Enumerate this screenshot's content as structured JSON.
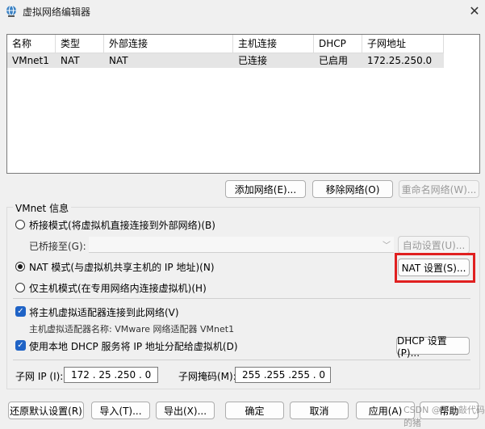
{
  "window": {
    "title": "虚拟网络编辑器",
    "close_glyph": "✕"
  },
  "table": {
    "columns": [
      "名称",
      "类型",
      "外部连接",
      "主机连接",
      "DHCP",
      "子网地址"
    ],
    "rows": [
      {
        "name": "VMnet1",
        "type": "NAT",
        "external": "NAT",
        "host": "已连接",
        "dhcp": "已启用",
        "subnet": "172.25.250.0"
      }
    ]
  },
  "table_buttons": {
    "add": "添加网络(E)...",
    "remove": "移除网络(O)",
    "rename": "重命名网络(W)..."
  },
  "vmnet_info": {
    "label": "VMnet 信息",
    "bridged_label": "桥接模式(将虚拟机直接连接到外部网络)(B)",
    "bridged_to_label": "已桥接至(G):",
    "bridged_to_value": "",
    "auto_settings": "自动设置(U)...",
    "nat_label": "NAT 模式(与虚拟机共享主机的 IP 地址)(N)",
    "nat_settings": "NAT 设置(S)...",
    "hostonly_label": "仅主机模式(在专用网络内连接虚拟机)(H)",
    "connect_adapter_label": "将主机虚拟适配器连接到此网络(V)",
    "adapter_name_label": "主机虚拟适配器名称: VMware 网络适配器 VMnet1",
    "dhcp_label": "使用本地 DHCP 服务将 IP 地址分配给虚拟机(D)",
    "dhcp_settings": "DHCP 设置(P)...",
    "subnet_ip_label": "子网 IP (I):",
    "subnet_ip_value": "172 . 25 .250 . 0",
    "subnet_mask_label": "子网掩码(M):",
    "subnet_mask_value": "255 .255 .255 . 0",
    "mode_selected": "nat"
  },
  "footer": {
    "restore": "还原默认设置(R)",
    "import": "导入(T)...",
    "export": "导出(X)...",
    "ok": "确定",
    "cancel": "取消",
    "apply": "应用(A)",
    "help": "帮助"
  },
  "watermark": "CSDN @不会敲代码的猪",
  "colors": {
    "accent": "#1f63c6",
    "highlight": "#e02020"
  }
}
